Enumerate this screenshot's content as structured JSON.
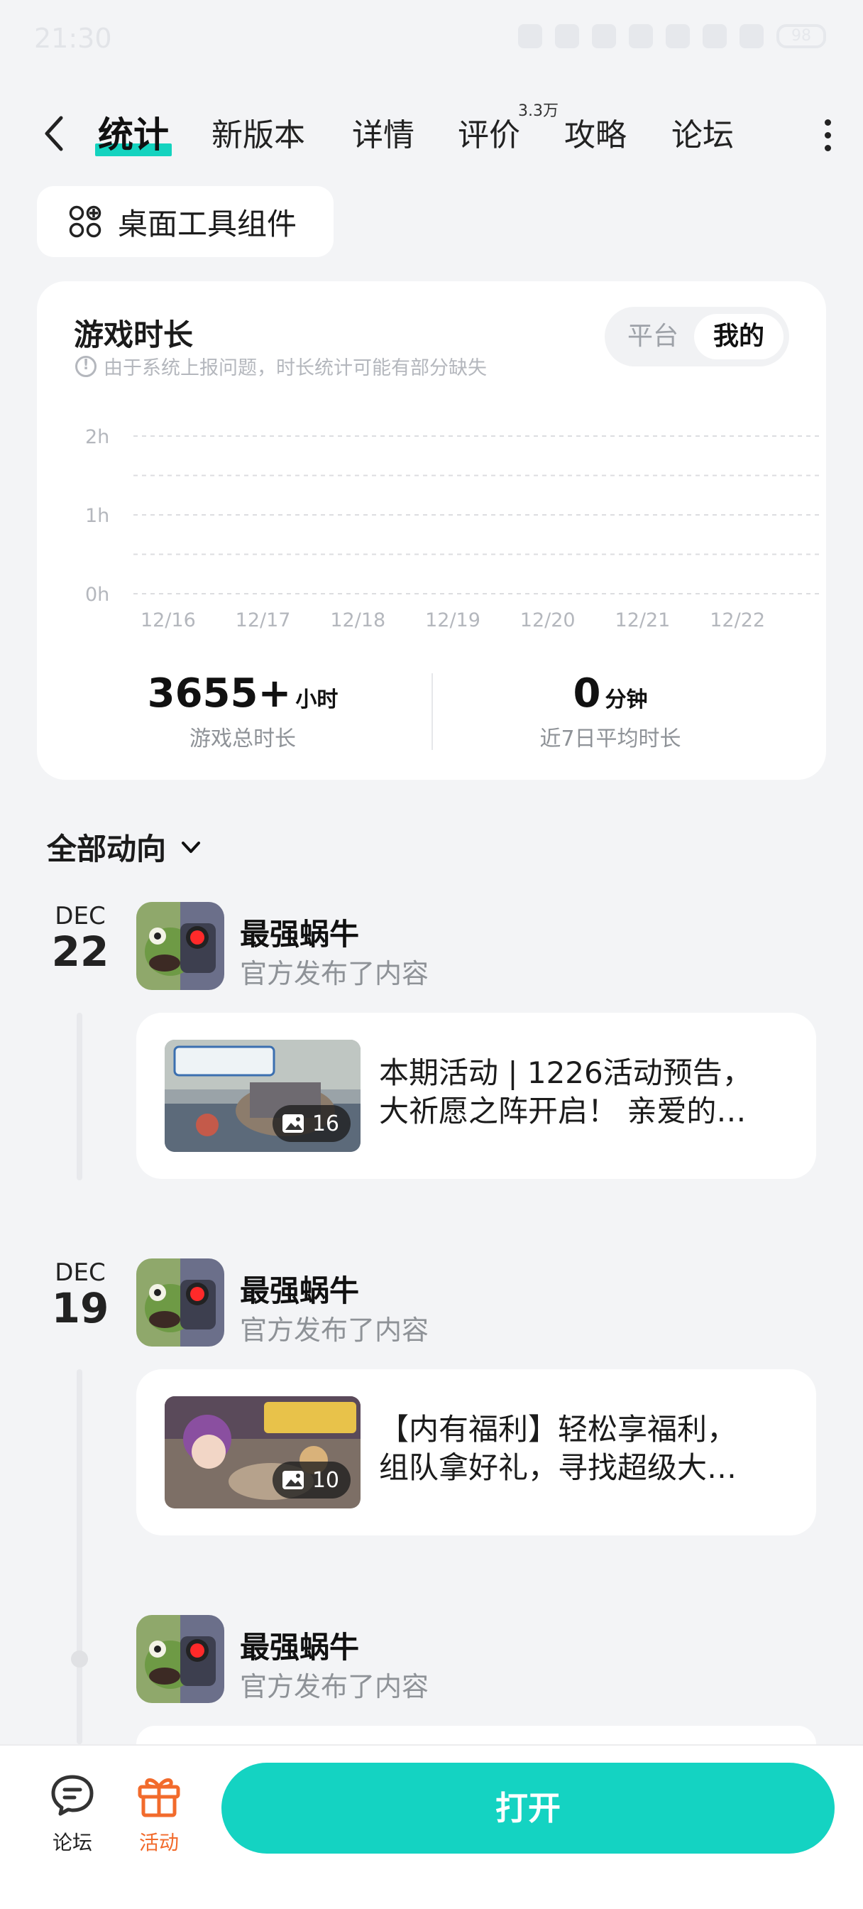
{
  "status_bar": {
    "time": "21:30",
    "battery": "98"
  },
  "header": {
    "tabs": [
      {
        "label": "统计",
        "active": true
      },
      {
        "label": "新版本"
      },
      {
        "label": "详情"
      },
      {
        "label": "评价",
        "badge": "3.3万"
      },
      {
        "label": "攻略"
      },
      {
        "label": "论坛"
      }
    ]
  },
  "widget_button": {
    "label": "桌面工具组件"
  },
  "stats": {
    "title": "游戏时长",
    "notice": "由于系统上报问题，时长统计可能有部分缺失",
    "toggle": {
      "platform": "平台",
      "mine": "我的"
    },
    "total": {
      "value": "3655+",
      "unit": "小时",
      "label": "游戏总时长"
    },
    "average": {
      "value": "0",
      "unit": "分钟",
      "label": "近7日平均时长"
    }
  },
  "chart_data": {
    "type": "bar",
    "categories": [
      "12/16",
      "12/17",
      "12/18",
      "12/19",
      "12/20",
      "12/21",
      "12/22"
    ],
    "values": [
      0,
      0,
      0,
      0,
      0,
      0,
      0
    ],
    "y_ticks": [
      "0h",
      "1h",
      "2h"
    ],
    "ylim": [
      0,
      2
    ],
    "grid": true
  },
  "feed": {
    "filter_label": "全部动向",
    "entries": [
      {
        "month": "DEC",
        "day": "22",
        "author": "最强蜗牛",
        "action": "官方发布了内容",
        "image_count": "16",
        "text_line1": "本期活动 | 1226活动预告，",
        "text_line2": "大祈愿之阵开启！ 亲爱的…"
      },
      {
        "month": "DEC",
        "day": "19",
        "author": "最强蜗牛",
        "action": "官方发布了内容",
        "image_count": "10",
        "text_line1": "【内有福利】轻松享福利，",
        "text_line2": "组队拿好礼，寻找超级大…"
      },
      {
        "author": "最强蜗牛",
        "action": "官方发布了内容"
      }
    ]
  },
  "bottom_bar": {
    "forum_label": "论坛",
    "activity_label": "活动",
    "open_label": "打开"
  },
  "colors": {
    "accent": "#14d3c2",
    "activity": "#f26b2c"
  }
}
